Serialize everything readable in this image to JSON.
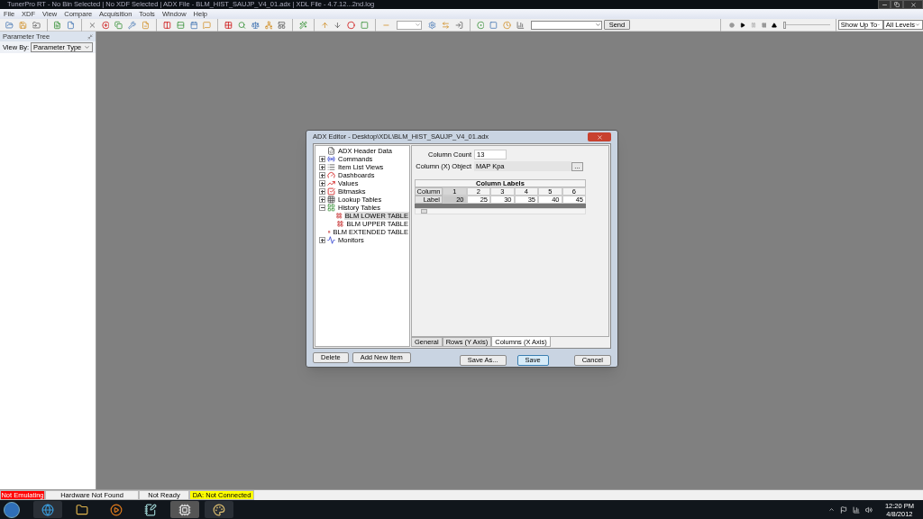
{
  "window": {
    "title": "TunerPro RT - No Bin Selected | No XDF Selected | ADX File - BLM_HIST_SAUJP_V4_01.adx | XDL File - 4.7.12...2nd.log"
  },
  "menu": [
    "File",
    "XDF",
    "View",
    "Compare",
    "Acquisition",
    "Tools",
    "Window",
    "Help"
  ],
  "toolbar": {
    "send_button": "Send",
    "playback": {
      "level": 0
    },
    "show_up_to": "Show Up To",
    "levels": "All Levels"
  },
  "parameter_tree": {
    "title": "Parameter Tree",
    "view_by_label": "View By:",
    "view_by_value": "Parameter Type"
  },
  "dialog": {
    "title": "ADX Editor - Desktop\\XDL\\BLM_HIST_SAUJP_V4_01.adx",
    "tree": [
      {
        "label": "ADX Header Data",
        "selected": false
      },
      {
        "label": "Commands",
        "expanded": false,
        "selected": false
      },
      {
        "label": "Item List Views",
        "expanded": false,
        "selected": false
      },
      {
        "label": "Dashboards",
        "expanded": false,
        "selected": false
      },
      {
        "label": "Values",
        "expanded": false,
        "selected": false
      },
      {
        "label": "Bitmasks",
        "expanded": false,
        "selected": false
      },
      {
        "label": "Lookup Tables",
        "expanded": false,
        "selected": false
      },
      {
        "label": "History Tables",
        "expanded": true,
        "selected": false,
        "children": [
          {
            "label": "BLM LOWER TABLE",
            "selected": true
          },
          {
            "label": "BLM UPPER TABLE",
            "selected": false
          },
          {
            "label": "BLM EXTENDED TABLE",
            "selected": false
          }
        ]
      },
      {
        "label": "Monitors",
        "expanded": false,
        "selected": false
      }
    ],
    "column_count_label": "Column Count",
    "column_count": "13",
    "column_object_label": "Column (X) Object",
    "column_object": "MAP Kpa",
    "browse_button": "...",
    "table": {
      "title": "Column Labels",
      "corner": "Column",
      "row_header": "Label",
      "columns": [
        "1",
        "2",
        "3",
        "4",
        "5",
        "6"
      ],
      "values": [
        {
          "text": "20",
          "selected": true
        },
        {
          "text": "25",
          "selected": false
        },
        {
          "text": "30",
          "selected": false
        },
        {
          "text": "35",
          "selected": false
        },
        {
          "text": "40",
          "selected": false
        },
        {
          "text": "45",
          "selected": false
        }
      ]
    },
    "tabs": [
      {
        "label": "General",
        "selected": false
      },
      {
        "label": "Rows (Y Axis)",
        "selected": false
      },
      {
        "label": "Columns (X Axis)",
        "selected": true
      }
    ],
    "left_buttons": [
      {
        "label": "Delete",
        "default": false
      },
      {
        "label": "Add New Item",
        "default": false
      }
    ],
    "right_buttons": [
      {
        "label": "Save As...",
        "default": false
      },
      {
        "label": "Save",
        "default": true
      },
      {
        "label": "Cancel",
        "default": false
      }
    ]
  },
  "status_bar": [
    {
      "text": "Not Emulating",
      "color": "#ff0000"
    },
    {
      "text": "Hardware Not Found",
      "color": "#f0f0f0"
    },
    {
      "text": "Not Ready",
      "color": "#f0f0f0"
    },
    {
      "text": "DA: Not Connected",
      "color": "#ffff00"
    }
  ],
  "taskbar": {
    "time": "12:20 PM",
    "date": "4/8/2012"
  }
}
